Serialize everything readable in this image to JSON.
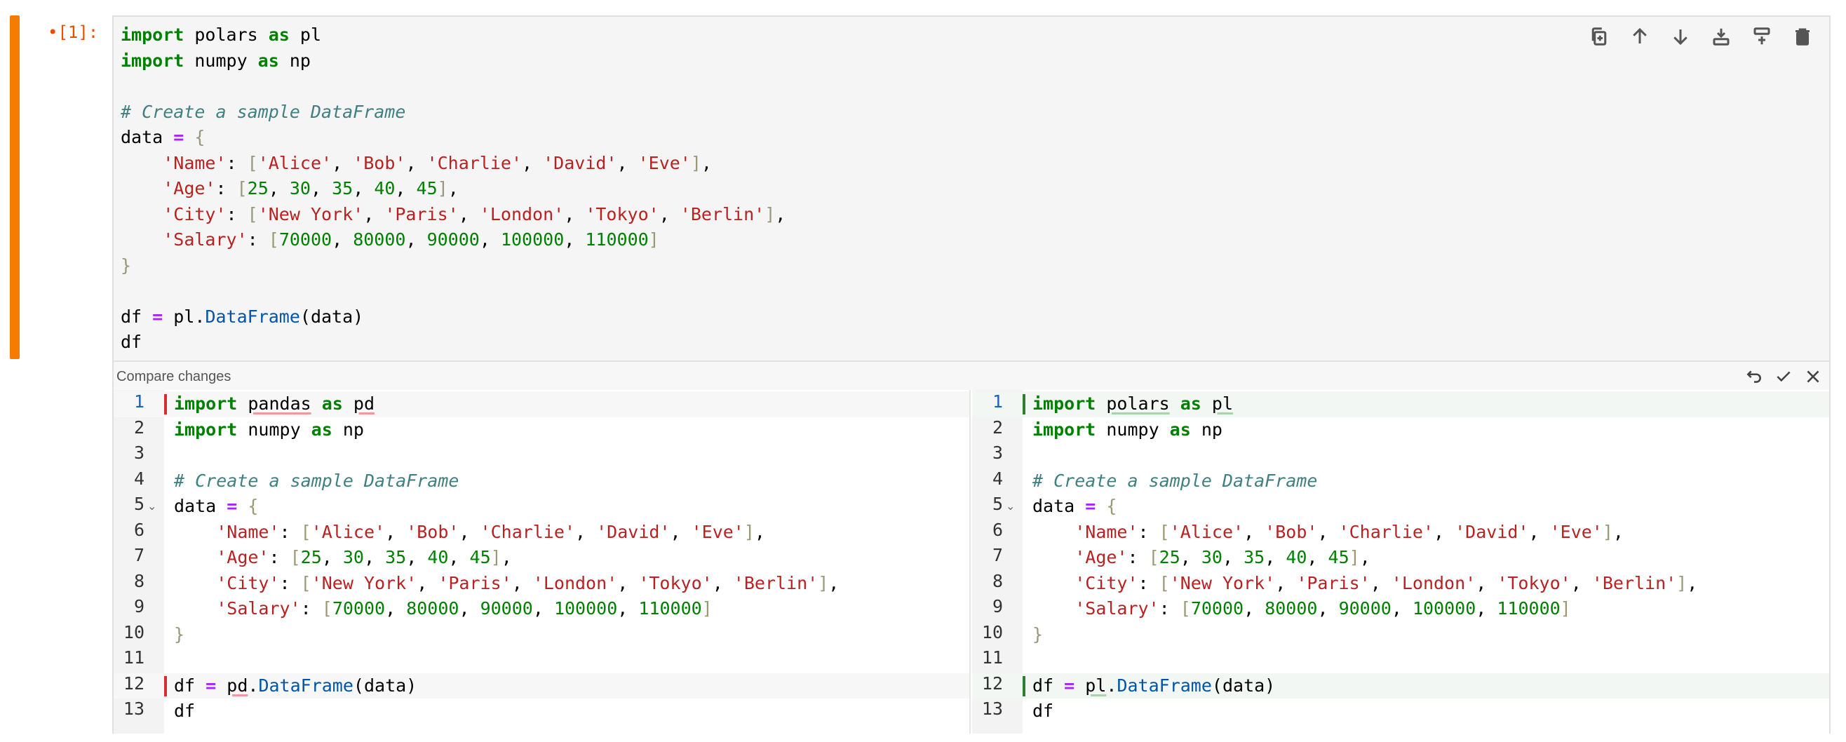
{
  "cell": {
    "prompt": "•[1]:",
    "lines": [
      [
        [
          "kw",
          "import"
        ],
        [
          "t",
          " polars "
        ],
        [
          "kw",
          "as"
        ],
        [
          "t",
          " pl"
        ]
      ],
      [
        [
          "kw",
          "import"
        ],
        [
          "t",
          " numpy "
        ],
        [
          "kw",
          "as"
        ],
        [
          "t",
          " np"
        ]
      ],
      [],
      [
        [
          "cm",
          "# Create a sample DataFrame"
        ]
      ],
      [
        [
          "t",
          "data "
        ],
        [
          "op",
          "="
        ],
        [
          "t",
          " "
        ],
        [
          "br",
          "{"
        ]
      ],
      [
        [
          "t",
          "    "
        ],
        [
          "st",
          "'Name'"
        ],
        [
          "t",
          ": "
        ],
        [
          "br",
          "["
        ],
        [
          "st",
          "'Alice'"
        ],
        [
          "t",
          ", "
        ],
        [
          "st",
          "'Bob'"
        ],
        [
          "t",
          ", "
        ],
        [
          "st",
          "'Charlie'"
        ],
        [
          "t",
          ", "
        ],
        [
          "st",
          "'David'"
        ],
        [
          "t",
          ", "
        ],
        [
          "st",
          "'Eve'"
        ],
        [
          "br",
          "]"
        ],
        [
          "t",
          ","
        ]
      ],
      [
        [
          "t",
          "    "
        ],
        [
          "st",
          "'Age'"
        ],
        [
          "t",
          ": "
        ],
        [
          "br",
          "["
        ],
        [
          "nm",
          "25"
        ],
        [
          "t",
          ", "
        ],
        [
          "nm",
          "30"
        ],
        [
          "t",
          ", "
        ],
        [
          "nm",
          "35"
        ],
        [
          "t",
          ", "
        ],
        [
          "nm",
          "40"
        ],
        [
          "t",
          ", "
        ],
        [
          "nm",
          "45"
        ],
        [
          "br",
          "]"
        ],
        [
          "t",
          ","
        ]
      ],
      [
        [
          "t",
          "    "
        ],
        [
          "st",
          "'City'"
        ],
        [
          "t",
          ": "
        ],
        [
          "br",
          "["
        ],
        [
          "st",
          "'New York'"
        ],
        [
          "t",
          ", "
        ],
        [
          "st",
          "'Paris'"
        ],
        [
          "t",
          ", "
        ],
        [
          "st",
          "'London'"
        ],
        [
          "t",
          ", "
        ],
        [
          "st",
          "'Tokyo'"
        ],
        [
          "t",
          ", "
        ],
        [
          "st",
          "'Berlin'"
        ],
        [
          "br",
          "]"
        ],
        [
          "t",
          ","
        ]
      ],
      [
        [
          "t",
          "    "
        ],
        [
          "st",
          "'Salary'"
        ],
        [
          "t",
          ": "
        ],
        [
          "br",
          "["
        ],
        [
          "nm",
          "70000"
        ],
        [
          "t",
          ", "
        ],
        [
          "nm",
          "80000"
        ],
        [
          "t",
          ", "
        ],
        [
          "nm",
          "90000"
        ],
        [
          "t",
          ", "
        ],
        [
          "nm",
          "100000"
        ],
        [
          "t",
          ", "
        ],
        [
          "nm",
          "110000"
        ],
        [
          "br",
          "]"
        ]
      ],
      [
        [
          "br",
          "}"
        ]
      ],
      [],
      [
        [
          "t",
          "df "
        ],
        [
          "op",
          "="
        ],
        [
          "t",
          " pl."
        ],
        [
          "fn",
          "DataFrame"
        ],
        [
          "t",
          "(data)"
        ]
      ],
      [
        [
          "t",
          "df"
        ]
      ]
    ]
  },
  "toolbar": {
    "icons": [
      "duplicate-icon",
      "move-up-icon",
      "move-down-icon",
      "insert-above-icon",
      "insert-below-icon",
      "delete-icon"
    ]
  },
  "diff": {
    "title": "Compare changes",
    "actions": [
      "undo-icon",
      "accept-icon",
      "close-icon"
    ],
    "line_numbers": [
      "1",
      "2",
      "3",
      "4",
      "5",
      "6",
      "7",
      "8",
      "9",
      "10",
      "11",
      "12",
      "13"
    ],
    "fold_line": 5,
    "active_line": 1,
    "left": {
      "changed": [
        1,
        12
      ],
      "lines": [
        [
          [
            "kw",
            "import"
          ],
          [
            "t",
            " "
          ],
          [
            "ur",
            "pandas"
          ],
          [
            "t",
            " "
          ],
          [
            "kw",
            "as"
          ],
          [
            "t",
            " "
          ],
          [
            "ur",
            "pd"
          ]
        ],
        [
          [
            "kw",
            "import"
          ],
          [
            "t",
            " numpy "
          ],
          [
            "kw",
            "as"
          ],
          [
            "t",
            " np"
          ]
        ],
        [],
        [
          [
            "cm",
            "# Create a sample DataFrame"
          ]
        ],
        [
          [
            "t",
            "data "
          ],
          [
            "op",
            "="
          ],
          [
            "t",
            " "
          ],
          [
            "br",
            "{"
          ]
        ],
        [
          [
            "t",
            "    "
          ],
          [
            "st",
            "'Name'"
          ],
          [
            "t",
            ": "
          ],
          [
            "br",
            "["
          ],
          [
            "st",
            "'Alice'"
          ],
          [
            "t",
            ", "
          ],
          [
            "st",
            "'Bob'"
          ],
          [
            "t",
            ", "
          ],
          [
            "st",
            "'Charlie'"
          ],
          [
            "t",
            ", "
          ],
          [
            "st",
            "'David'"
          ],
          [
            "t",
            ", "
          ],
          [
            "st",
            "'Eve'"
          ],
          [
            "br",
            "]"
          ],
          [
            "t",
            ","
          ]
        ],
        [
          [
            "t",
            "    "
          ],
          [
            "st",
            "'Age'"
          ],
          [
            "t",
            ": "
          ],
          [
            "br",
            "["
          ],
          [
            "nm",
            "25"
          ],
          [
            "t",
            ", "
          ],
          [
            "nm",
            "30"
          ],
          [
            "t",
            ", "
          ],
          [
            "nm",
            "35"
          ],
          [
            "t",
            ", "
          ],
          [
            "nm",
            "40"
          ],
          [
            "t",
            ", "
          ],
          [
            "nm",
            "45"
          ],
          [
            "br",
            "]"
          ],
          [
            "t",
            ","
          ]
        ],
        [
          [
            "t",
            "    "
          ],
          [
            "st",
            "'City'"
          ],
          [
            "t",
            ": "
          ],
          [
            "br",
            "["
          ],
          [
            "st",
            "'New York'"
          ],
          [
            "t",
            ", "
          ],
          [
            "st",
            "'Paris'"
          ],
          [
            "t",
            ", "
          ],
          [
            "st",
            "'London'"
          ],
          [
            "t",
            ", "
          ],
          [
            "st",
            "'Tokyo'"
          ],
          [
            "t",
            ", "
          ],
          [
            "st",
            "'Berlin'"
          ],
          [
            "br",
            "]"
          ],
          [
            "t",
            ","
          ]
        ],
        [
          [
            "t",
            "    "
          ],
          [
            "st",
            "'Salary'"
          ],
          [
            "t",
            ": "
          ],
          [
            "br",
            "["
          ],
          [
            "nm",
            "70000"
          ],
          [
            "t",
            ", "
          ],
          [
            "nm",
            "80000"
          ],
          [
            "t",
            ", "
          ],
          [
            "nm",
            "90000"
          ],
          [
            "t",
            ", "
          ],
          [
            "nm",
            "100000"
          ],
          [
            "t",
            ", "
          ],
          [
            "nm",
            "110000"
          ],
          [
            "br",
            "]"
          ]
        ],
        [
          [
            "br",
            "}"
          ]
        ],
        [],
        [
          [
            "t",
            "df "
          ],
          [
            "op",
            "="
          ],
          [
            "t",
            " "
          ],
          [
            "ur",
            "pd"
          ],
          [
            "t",
            "."
          ],
          [
            "fn",
            "DataFrame"
          ],
          [
            "t",
            "(data)"
          ]
        ],
        [
          [
            "t",
            "df"
          ]
        ]
      ]
    },
    "right": {
      "changed": [
        1,
        12
      ],
      "lines": [
        [
          [
            "kw",
            "import"
          ],
          [
            "t",
            " "
          ],
          [
            "ug",
            "polars"
          ],
          [
            "t",
            " "
          ],
          [
            "kw",
            "as"
          ],
          [
            "t",
            " "
          ],
          [
            "ug",
            "pl"
          ]
        ],
        [
          [
            "kw",
            "import"
          ],
          [
            "t",
            " numpy "
          ],
          [
            "kw",
            "as"
          ],
          [
            "t",
            " np"
          ]
        ],
        [],
        [
          [
            "cm",
            "# Create a sample DataFrame"
          ]
        ],
        [
          [
            "t",
            "data "
          ],
          [
            "op",
            "="
          ],
          [
            "t",
            " "
          ],
          [
            "br",
            "{"
          ]
        ],
        [
          [
            "t",
            "    "
          ],
          [
            "st",
            "'Name'"
          ],
          [
            "t",
            ": "
          ],
          [
            "br",
            "["
          ],
          [
            "st",
            "'Alice'"
          ],
          [
            "t",
            ", "
          ],
          [
            "st",
            "'Bob'"
          ],
          [
            "t",
            ", "
          ],
          [
            "st",
            "'Charlie'"
          ],
          [
            "t",
            ", "
          ],
          [
            "st",
            "'David'"
          ],
          [
            "t",
            ", "
          ],
          [
            "st",
            "'Eve'"
          ],
          [
            "br",
            "]"
          ],
          [
            "t",
            ","
          ]
        ],
        [
          [
            "t",
            "    "
          ],
          [
            "st",
            "'Age'"
          ],
          [
            "t",
            ": "
          ],
          [
            "br",
            "["
          ],
          [
            "nm",
            "25"
          ],
          [
            "t",
            ", "
          ],
          [
            "nm",
            "30"
          ],
          [
            "t",
            ", "
          ],
          [
            "nm",
            "35"
          ],
          [
            "t",
            ", "
          ],
          [
            "nm",
            "40"
          ],
          [
            "t",
            ", "
          ],
          [
            "nm",
            "45"
          ],
          [
            "br",
            "]"
          ],
          [
            "t",
            ","
          ]
        ],
        [
          [
            "t",
            "    "
          ],
          [
            "st",
            "'City'"
          ],
          [
            "t",
            ": "
          ],
          [
            "br",
            "["
          ],
          [
            "st",
            "'New York'"
          ],
          [
            "t",
            ", "
          ],
          [
            "st",
            "'Paris'"
          ],
          [
            "t",
            ", "
          ],
          [
            "st",
            "'London'"
          ],
          [
            "t",
            ", "
          ],
          [
            "st",
            "'Tokyo'"
          ],
          [
            "t",
            ", "
          ],
          [
            "st",
            "'Berlin'"
          ],
          [
            "br",
            "]"
          ],
          [
            "t",
            ","
          ]
        ],
        [
          [
            "t",
            "    "
          ],
          [
            "st",
            "'Salary'"
          ],
          [
            "t",
            ": "
          ],
          [
            "br",
            "["
          ],
          [
            "nm",
            "70000"
          ],
          [
            "t",
            ", "
          ],
          [
            "nm",
            "80000"
          ],
          [
            "t",
            ", "
          ],
          [
            "nm",
            "90000"
          ],
          [
            "t",
            ", "
          ],
          [
            "nm",
            "100000"
          ],
          [
            "t",
            ", "
          ],
          [
            "nm",
            "110000"
          ],
          [
            "br",
            "]"
          ]
        ],
        [
          [
            "br",
            "}"
          ]
        ],
        [],
        [
          [
            "t",
            "df "
          ],
          [
            "op",
            "="
          ],
          [
            "t",
            " "
          ],
          [
            "ug",
            "pl"
          ],
          [
            "t",
            "."
          ],
          [
            "fn",
            "DataFrame"
          ],
          [
            "t",
            "(data)"
          ]
        ],
        [
          [
            "t",
            "df"
          ]
        ]
      ]
    }
  }
}
